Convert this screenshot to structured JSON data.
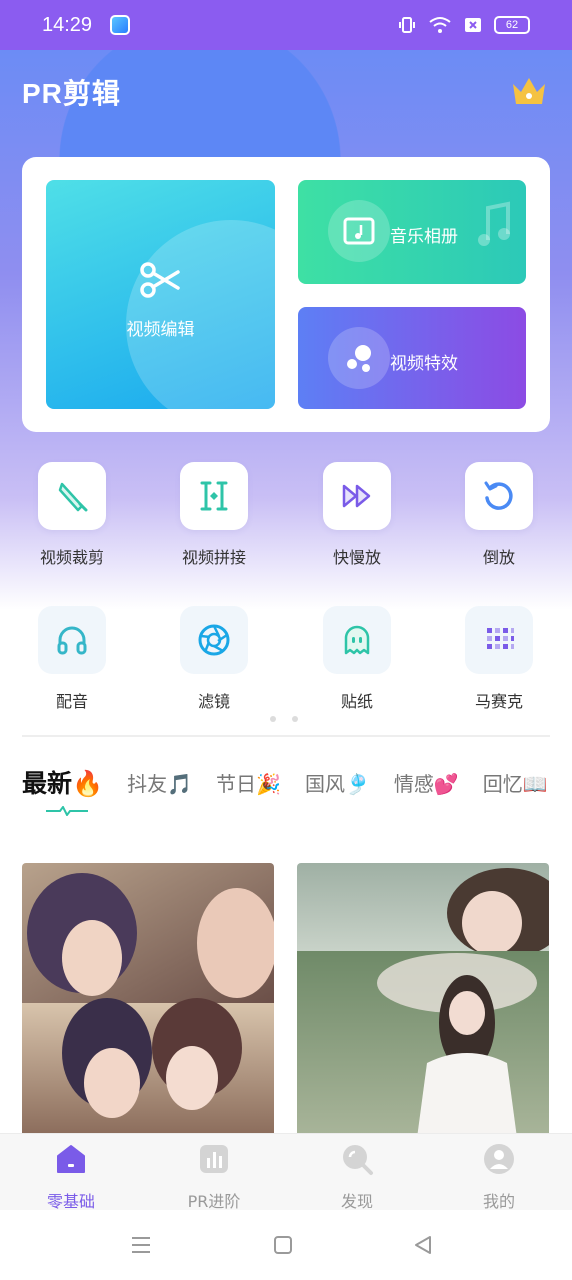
{
  "status_bar": {
    "time": "14:29",
    "battery": "62"
  },
  "header": {
    "app_title": "PR剪辑"
  },
  "feature_tiles": [
    {
      "label": "视频编辑",
      "icon": "scissors-icon"
    },
    {
      "label": "音乐相册",
      "icon": "music-album-icon"
    },
    {
      "label": "视频特效",
      "icon": "bubbles-icon"
    }
  ],
  "tools": [
    {
      "label": "视频裁剪",
      "icon": "knife-icon"
    },
    {
      "label": "视频拼接",
      "icon": "splice-icon"
    },
    {
      "label": "快慢放",
      "icon": "fast-forward-icon"
    },
    {
      "label": "倒放",
      "icon": "rewind-icon"
    },
    {
      "label": "配音",
      "icon": "headphones-icon"
    },
    {
      "label": "滤镜",
      "icon": "aperture-icon"
    },
    {
      "label": "贴纸",
      "icon": "ghost-icon"
    },
    {
      "label": "马赛克",
      "icon": "mosaic-icon"
    }
  ],
  "tabs": [
    {
      "label": "最新🔥"
    },
    {
      "label": "抖友🎵"
    },
    {
      "label": "节日🎉"
    },
    {
      "label": "国风🎐"
    },
    {
      "label": "情感💕"
    },
    {
      "label": "回忆📖"
    }
  ],
  "bottom_nav": [
    {
      "label": "零基础",
      "icon": "home-icon"
    },
    {
      "label": "PR进阶",
      "icon": "chart-icon"
    },
    {
      "label": "发现",
      "icon": "discover-icon"
    },
    {
      "label": "我的",
      "icon": "profile-icon"
    }
  ],
  "colors": {
    "accent": "#7a5be8",
    "status_bar": "#8b5cf0",
    "teal": "#2ec4a8"
  }
}
